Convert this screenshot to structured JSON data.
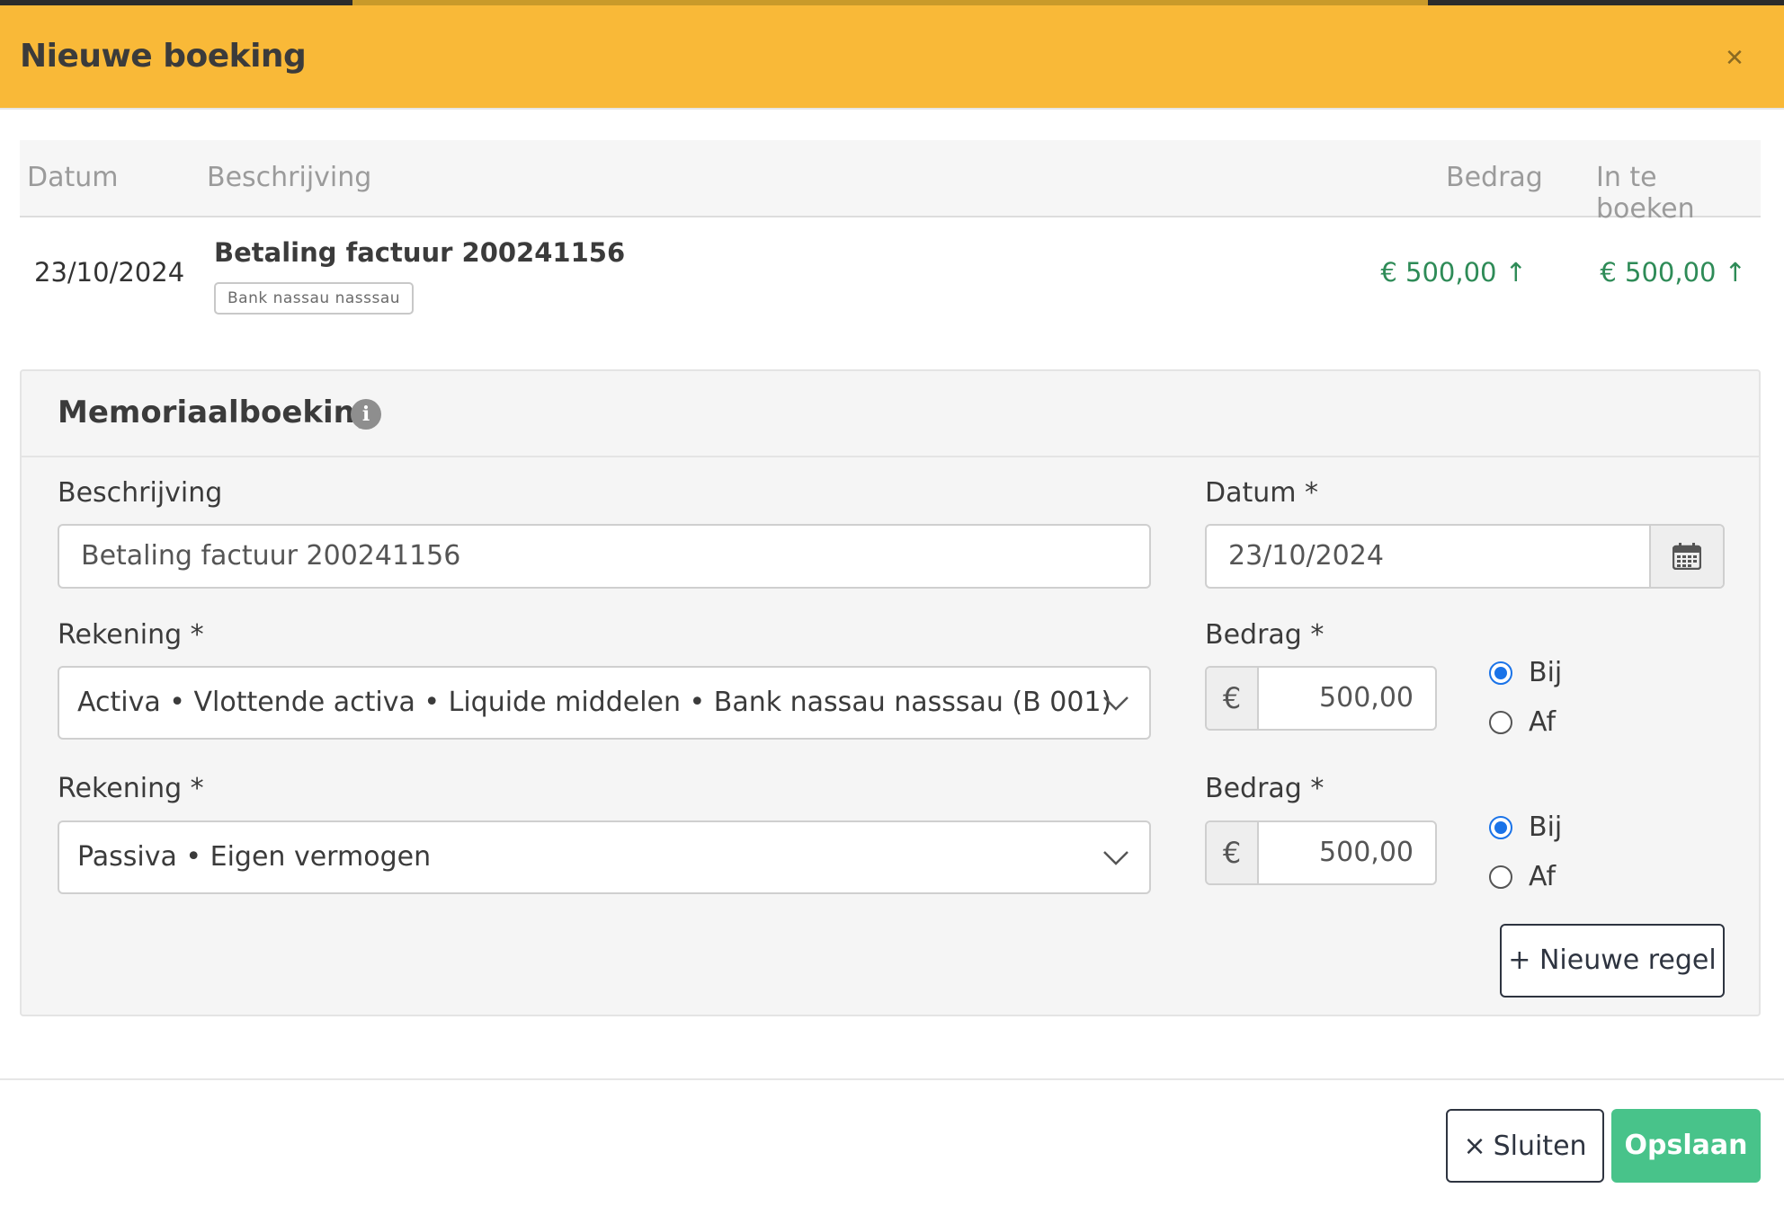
{
  "header": {
    "title": "Nieuwe boeking",
    "close_icon": "close-icon",
    "accent_color": "#f9b938"
  },
  "table": {
    "columns": [
      "Datum",
      "Beschrijving",
      "Bedrag",
      "In te boeken"
    ],
    "rows": [
      {
        "date": "23/10/2024",
        "description": "Betaling factuur 200241156",
        "tag": "Bank nassau nasssau",
        "amount": "€ 500,00 ↑",
        "to_book": "€ 500,00 ↑",
        "amount_color": "#2e8b57"
      }
    ]
  },
  "memo": {
    "title": "Memoriaalboeking",
    "info_icon": "info-icon",
    "description_label": "Beschrijving",
    "description_value": "Betaling factuur 200241156",
    "date_label": "Datum *",
    "date_value": "23/10/2024",
    "lines": [
      {
        "account_label": "Rekening *",
        "account_value": "Activa • Vlottende activa • Liquide middelen • Bank nassau nasssau (B 001)",
        "amount_label": "Bedrag *",
        "currency": "€",
        "amount_value": "500,00",
        "radio_bij": "Bij",
        "radio_af": "Af",
        "selected": "Bij"
      },
      {
        "account_label": "Rekening *",
        "account_value": "Passiva • Eigen vermogen",
        "amount_label": "Bedrag *",
        "currency": "€",
        "amount_value": "500,00",
        "radio_bij": "Bij",
        "radio_af": "Af",
        "selected": "Bij"
      }
    ],
    "new_rule_label": "+ Nieuwe regel"
  },
  "footer": {
    "close_label": "Sluiten",
    "close_symbol": "×",
    "save_label": "Opslaan",
    "save_color": "#48c38a"
  }
}
